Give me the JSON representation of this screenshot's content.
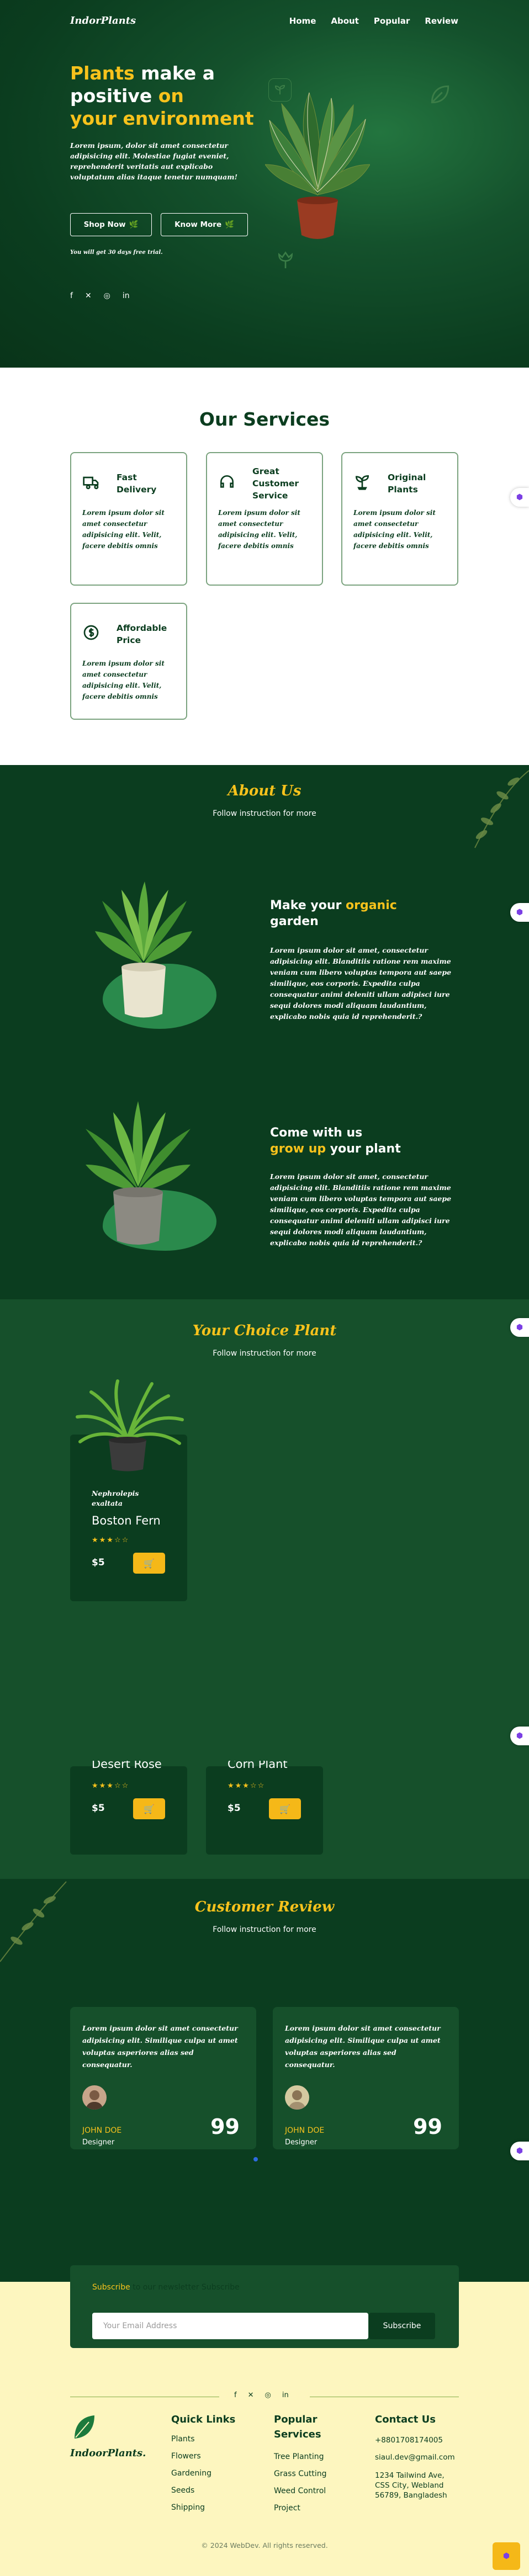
{
  "header": {
    "logo": "IndorPlants",
    "nav": [
      "Home",
      "About",
      "Popular",
      "Review"
    ]
  },
  "hero": {
    "title_a": "Plants",
    "title_b": " make a",
    "title_c": "positive ",
    "title_d": "on",
    "title_e": "your environment",
    "desc": "Lorem ipsum, dolor sit amet consectetur adipisicing elit. Molestiae fugiat eveniet, reprehenderit veritatis aut explicabo voluptatum alias itaque tenetur numquam!",
    "btn_shop": "Shop Now",
    "btn_know": "Know More",
    "trial": "You will get 30 days free trial.",
    "social": [
      "facebook-icon",
      "x-icon",
      "instagram-icon",
      "linkedin-icon"
    ]
  },
  "services": {
    "title": "Our Services",
    "items": [
      {
        "title": "Fast Delivery",
        "icon": "truck-icon",
        "desc": "Lorem ipsum dolor sit amet consectetur adipisicing elit. Velit, facere debitis omnis"
      },
      {
        "title": "Great Customer Service",
        "icon": "headset-icon",
        "desc": "Lorem ipsum dolor sit amet consectetur adipisicing elit. Velit, facere debitis omnis"
      },
      {
        "title": "Original Plants",
        "icon": "sprout-icon",
        "desc": "Lorem ipsum dolor sit amet consectetur adipisicing elit. Velit, facere debitis omnis"
      },
      {
        "title": "Affordable Price",
        "icon": "dollar-icon",
        "desc": "Lorem ipsum dolor sit amet consectetur adipisicing elit. Velit, facere debitis omnis"
      }
    ]
  },
  "about": {
    "title": "About Us",
    "subtitle": "Follow instruction for more",
    "row1": {
      "h_a": "Make your ",
      "h_b": "organic",
      "h_c": "garden",
      "desc": "Lorem ipsum dolor sit amet, consectetur adipisicing elit. Blanditiis ratione rem maxime veniam cum libero voluptas tempora aut saepe similique, eos corporis. Expedita culpa consequatur animi deleniti ullam adipisci iure sequi dolores modi aliquam laudantium, explicabo nobis quia id reprehenderit.?"
    },
    "row2": {
      "h_a": "Come with us",
      "h_b": "grow up",
      "h_c": " your plant",
      "desc": "Lorem ipsum dolor sit amet, consectetur adipisicing elit. Blanditiis ratione rem maxime veniam cum libero voluptas tempora aut saepe similique, eos corporis. Expedita culpa consequatur animi deleniti ullam adipisci iure sequi dolores modi aliquam laudantium, explicabo nobis quia id reprehenderit.?"
    }
  },
  "choice": {
    "title": "Your Choice Plant",
    "subtitle": "Follow instruction for more",
    "featured": {
      "latin": "Nephrolepis exaltata",
      "name": "Boston Fern",
      "price": "$5",
      "stars": "★★★☆☆"
    },
    "partial": [
      {
        "name": "Desert Rose",
        "price": "$5",
        "stars": "★★★☆☆"
      },
      {
        "name": "Corn Plant",
        "price": "$5",
        "stars": "★★★☆☆"
      }
    ]
  },
  "review": {
    "title": "Customer Review",
    "subtitle": "Follow instruction for more",
    "items": [
      {
        "text": "Lorem ipsum dolor sit amet consectetur adipisicing elit. Similique culpa ut amet voluptas asperiores alias sed consequatur.",
        "name": "JOHN DOE",
        "role": "Designer"
      },
      {
        "text": "Lorem ipsum dolor sit amet consectetur adipisicing elit. Similique culpa ut amet voluptas asperiores alias sed consequatur.",
        "name": "JOHN DOE",
        "role": "Designer"
      }
    ],
    "quote": "99"
  },
  "newsletter": {
    "label_a": "Subscribe",
    "label_b": " to our newsletter Subscribe",
    "placeholder": "Your Email Address",
    "button": "Subscribe"
  },
  "footer": {
    "logo": "IndoorPlants.",
    "quick": {
      "title": "Quick Links",
      "items": [
        "Plants",
        "Flowers",
        "Gardening",
        "Seeds",
        "Shipping"
      ]
    },
    "popular": {
      "title": "Popular Services",
      "items": [
        "Tree Planting",
        "Grass Cutting",
        "Weed Control",
        "Project"
      ]
    },
    "contact": {
      "title": "Contact Us",
      "items": [
        "+8801708174005",
        "siaul.dev@gmail.com",
        "1234 Tailwind Ave, CSS City, Webland 56789, Bangladesh"
      ]
    },
    "copyright": "© 2024 WebDev. All rights reserved."
  },
  "colors": {
    "dark_green": "#0b3d1f",
    "mid_green": "#16502b",
    "accent_yellow": "#f7c21c",
    "cream": "#fdf6bf"
  }
}
